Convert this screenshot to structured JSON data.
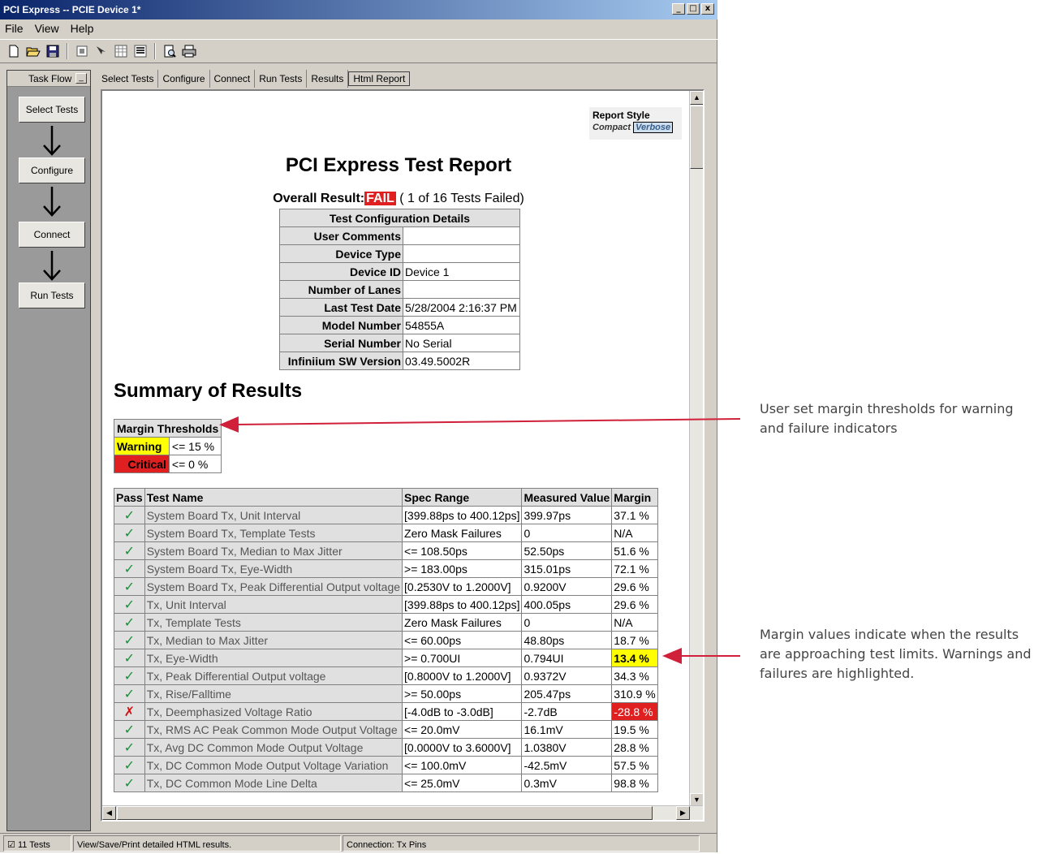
{
  "window": {
    "title": "PCI Express -- PCIE Device 1*",
    "controls": [
      "_",
      "□",
      "x"
    ]
  },
  "menu": [
    "File",
    "View",
    "Help"
  ],
  "toolbar_icons": [
    "new-icon",
    "open-icon",
    "save-icon",
    "properties-icon",
    "pointer-icon",
    "grid-icon",
    "list-icon",
    "print-preview-icon",
    "print-icon"
  ],
  "taskflow": {
    "title": "Task Flow",
    "steps": [
      "Select Tests",
      "Configure",
      "Connect",
      "Run Tests"
    ]
  },
  "tabs": [
    "Select Tests",
    "Configure",
    "Connect",
    "Run Tests",
    "Results",
    "Html Report"
  ],
  "active_tab": "Html Report",
  "report": {
    "style_label": "Report Style",
    "style_compact": "Compact",
    "style_verbose": "Verbose",
    "title": "PCI Express Test Report",
    "overall_label": "Overall Result:",
    "overall_status": "FAIL",
    "overall_detail": "( 1 of 16 Tests Failed)",
    "config": {
      "header": "Test Configuration Details",
      "rows": [
        {
          "key": "User Comments",
          "value": ""
        },
        {
          "key": "Device Type",
          "value": ""
        },
        {
          "key": "Device ID",
          "value": "Device 1"
        },
        {
          "key": "Number of Lanes",
          "value": ""
        },
        {
          "key": "Last Test Date",
          "value": "5/28/2004 2:16:37 PM"
        },
        {
          "key": "Model Number",
          "value": "54855A"
        },
        {
          "key": "Serial Number",
          "value": "No Serial"
        },
        {
          "key": "Infiniium SW Version",
          "value": "03.49.5002R"
        }
      ]
    },
    "summary_title": "Summary of Results",
    "thresholds": {
      "header": "Margin Thresholds",
      "warning_label": "Warning",
      "warning_value": "<= 15 %",
      "critical_label": "Critical",
      "critical_value": "<= 0 %"
    },
    "results": {
      "columns": [
        "Pass",
        "Test Name",
        "Spec Range",
        "Measured Value",
        "Margin"
      ],
      "rows": [
        {
          "pass": true,
          "name": "System Board Tx, Unit Interval",
          "spec": "[399.88ps to 400.12ps]",
          "measured": "399.97ps",
          "margin": "37.1 %",
          "level": "normal"
        },
        {
          "pass": true,
          "name": "System Board Tx, Template Tests",
          "spec": "Zero Mask Failures",
          "measured": "0",
          "margin": "N/A",
          "level": "normal"
        },
        {
          "pass": true,
          "name": "System Board Tx, Median to Max Jitter",
          "spec": "<= 108.50ps",
          "measured": "52.50ps",
          "margin": "51.6 %",
          "level": "normal"
        },
        {
          "pass": true,
          "name": "System Board Tx, Eye-Width",
          "spec": ">= 183.00ps",
          "measured": "315.01ps",
          "margin": "72.1 %",
          "level": "normal"
        },
        {
          "pass": true,
          "name": "System Board Tx, Peak Differential Output voltage",
          "spec": "[0.2530V to 1.2000V]",
          "measured": "0.9200V",
          "margin": "29.6 %",
          "level": "normal"
        },
        {
          "pass": true,
          "name": "Tx, Unit Interval",
          "spec": "[399.88ps to 400.12ps]",
          "measured": "400.05ps",
          "margin": "29.6 %",
          "level": "normal"
        },
        {
          "pass": true,
          "name": "Tx, Template Tests",
          "spec": "Zero Mask Failures",
          "measured": "0",
          "margin": "N/A",
          "level": "normal"
        },
        {
          "pass": true,
          "name": "Tx, Median to Max Jitter",
          "spec": "<= 60.00ps",
          "measured": "48.80ps",
          "margin": "18.7 %",
          "level": "normal"
        },
        {
          "pass": true,
          "name": "Tx, Eye-Width",
          "spec": ">= 0.700UI",
          "measured": "0.794UI",
          "margin": "13.4 %",
          "level": "warn"
        },
        {
          "pass": true,
          "name": "Tx, Peak Differential Output voltage",
          "spec": "[0.8000V to 1.2000V]",
          "measured": "0.9372V",
          "margin": "34.3 %",
          "level": "normal"
        },
        {
          "pass": true,
          "name": "Tx, Rise/Falltime",
          "spec": ">= 50.00ps",
          "measured": "205.47ps",
          "margin": "310.9 %",
          "level": "normal"
        },
        {
          "pass": false,
          "name": "Tx, Deemphasized Voltage Ratio",
          "spec": "[-4.0dB to -3.0dB]",
          "measured": "-2.7dB",
          "margin": "-28.8 %",
          "level": "crit"
        },
        {
          "pass": true,
          "name": "Tx, RMS AC Peak Common Mode Output Voltage",
          "spec": "<= 20.0mV",
          "measured": "16.1mV",
          "margin": "19.5 %",
          "level": "normal"
        },
        {
          "pass": true,
          "name": "Tx, Avg DC Common Mode Output Voltage",
          "spec": "[0.0000V to 3.6000V]",
          "measured": "1.0380V",
          "margin": "28.8 %",
          "level": "normal"
        },
        {
          "pass": true,
          "name": "Tx, DC Common Mode Output Voltage Variation",
          "spec": "<= 100.0mV",
          "measured": "-42.5mV",
          "margin": "57.5 %",
          "level": "normal"
        },
        {
          "pass": true,
          "name": "Tx, DC Common Mode Line Delta",
          "spec": "<= 25.0mV",
          "measured": "0.3mV",
          "margin": "98.8 %",
          "level": "normal"
        }
      ]
    }
  },
  "statusbar": {
    "tests": "11 Tests",
    "message": "View/Save/Print detailed HTML results.",
    "connection": "Connection: Tx Pins"
  },
  "annotations": {
    "thresholds": "User set margin thresholds for warning and failure indicators",
    "margins": "Margin values indicate when the results are approaching test limits. Warnings and failures are highlighted."
  },
  "colors": {
    "warning": "#ffff00",
    "critical": "#e02020",
    "pass_check": "#1a8f3a",
    "fail_x": "#d01010",
    "annotation_arrow": "#d0203a"
  }
}
